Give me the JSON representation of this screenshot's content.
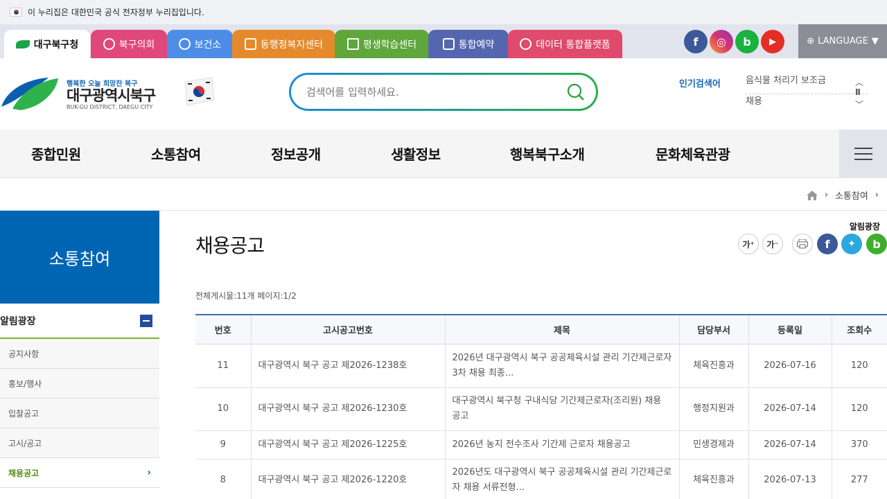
{
  "gov_banner": {
    "text": "이 누리집은 대한민국 공식 전자정부 누리집입니다."
  },
  "site_tabs": [
    {
      "label": "대구북구청",
      "color": "#ffffff",
      "active": true
    },
    {
      "label": "북구의회",
      "color": "#e0477a"
    },
    {
      "label": "보건소",
      "color": "#4d8de8"
    },
    {
      "label": "동행정복지센터",
      "color": "#e58a2c"
    },
    {
      "label": "평생학습센터",
      "color": "#5fa63b"
    },
    {
      "label": "통합예약",
      "color": "#5566b0"
    },
    {
      "label": "데이터 통합플랫폼",
      "color": "#e04a6c"
    }
  ],
  "sns_top": [
    {
      "name": "facebook-icon",
      "glyph": "f",
      "color": "#3b5998"
    },
    {
      "name": "instagram-icon",
      "glyph": "◎",
      "color": "#d8336f"
    },
    {
      "name": "blog-icon",
      "glyph": "b",
      "color": "#19b13f"
    },
    {
      "name": "youtube-icon",
      "glyph": "▶",
      "color": "#e52d27"
    }
  ],
  "language": {
    "label": "LANGUAGE"
  },
  "logo": {
    "slogan": "행복한 오늘 희망찬 북구",
    "name": "대구광역시북구",
    "english": "BUK-GU DISTRICT, DAEGU CITY"
  },
  "search": {
    "placeholder": "검색어를 입력하세요."
  },
  "popular": {
    "label": "인기검색어",
    "items": [
      "음식물 처리기 보조금",
      "채용"
    ]
  },
  "gnb": [
    "종합민원",
    "소통참여",
    "정보공개",
    "생활정보",
    "행복북구소개",
    "문화체육관광"
  ],
  "location": {
    "current": "소통참여"
  },
  "lnb": {
    "title": "소통참여",
    "group": "알림광장",
    "items": [
      "공지사항",
      "홍보/행사",
      "입찰공고",
      "고시/공고",
      "채용공고"
    ],
    "current_index": 4
  },
  "content": {
    "title": "채용공고",
    "section": "알림광장",
    "count_info": "전체게시물:11개 페이지:1/2",
    "utilities": {
      "font_up": "가⁺",
      "font_down": "가⁻"
    }
  },
  "table": {
    "headers": [
      "번호",
      "고시공고번호",
      "제목",
      "담당부서",
      "등록일",
      "조회수"
    ],
    "rows": [
      [
        "11",
        "대구광역시 북구 공고 제2026-1238호",
        "2026년 대구광역시 북구 공공체육시설 관리 기간제근로자 3차 채용 최종...",
        "체육진흥과",
        "2026-07-16",
        "120"
      ],
      [
        "10",
        "대구광역시 북구 공고 제2026-1230호",
        "대구광역시 북구청 구내식당 기간제근로자(조리원) 채용 공고",
        "행정지원과",
        "2026-07-14",
        "120"
      ],
      [
        "9",
        "대구광역시 북구 공고 제2026-1225호",
        "2026년 농지 전수조사 기간제 근로자 채용공고",
        "민생경제과",
        "2026-07-14",
        "370"
      ],
      [
        "8",
        "대구광역시 북구 공고 제2026-1220호",
        "2026년도 대구광역시 북구 공공체육시설 관리 기간제근로자 채용 서류전형...",
        "체육진흥과",
        "2026-07-13",
        "277"
      ]
    ]
  }
}
